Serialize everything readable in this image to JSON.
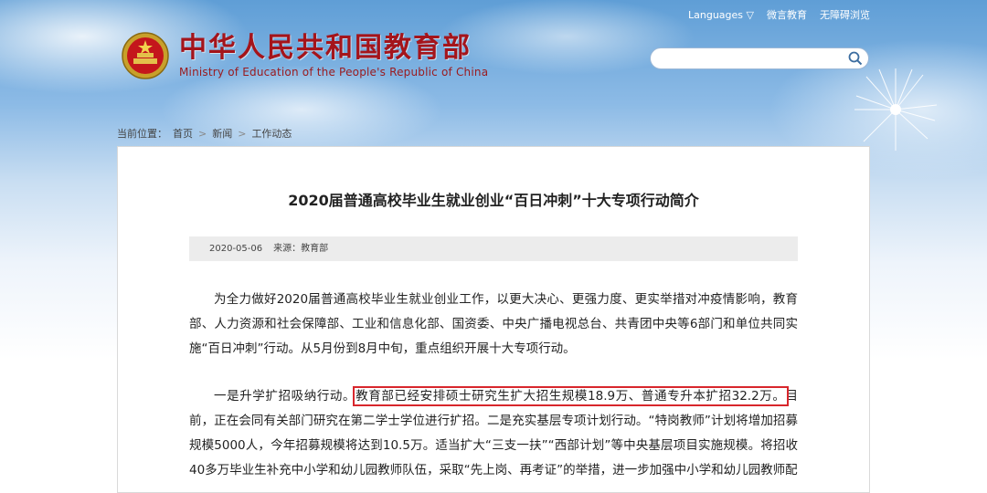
{
  "header": {
    "top_links": [
      "Languages ▽",
      "微言教育",
      "无障碍浏览"
    ],
    "site_title": "中华人民共和国教育部",
    "site_subtitle": "Ministry of Education of the People's Republic of China"
  },
  "breadcrumb": {
    "label": "当前位置：",
    "items": [
      "首页",
      "新闻",
      "工作动态"
    ],
    "separator": ">"
  },
  "article": {
    "title": "2020届普通高校毕业生就业创业“百日冲刺”十大专项行动简介",
    "date": "2020-05-06",
    "source": "来源：教育部",
    "paragraph1": "为全力做好2020届普通高校毕业生就业创业工作，以更大决心、更强力度、更实举措对冲疫情影响，教育部、人力资源和社会保障部、工业和信息化部、国资委、中央广播电视总台、共青团中央等6部门和单位共同实施“百日冲刺”行动。从5月份到8月中旬，重点组织开展十大专项行动。",
    "paragraph2_start": "一是升学扩招吸纳行动。",
    "paragraph2_highlight": "教育部已经安排硕士研究生扩大招生规模18.9万、普通专升本扩招32.2万。",
    "paragraph2_rest": "目前，正在会同有关部门研究在第二学士学位进行扩招。二是充实基层专项计划行动。“特岗教师”计划将增加招募规模5000人，今年招募规模将达到10.5万。适当扩大“三支一扶”“西部计划”等中央基层项目实施规模。将招收40多万毕业生补充中小学和幼儿园教师队伍，采取“先上岗、再考证”的举措，进一步加强中小学和幼儿园教师配"
  },
  "colors": {
    "brand_red": "#a4141b",
    "highlight_border": "#d8262c",
    "meta_bar": "#ececec"
  },
  "icons": [
    "national-emblem-icon",
    "search-icon",
    "dandelion-icon"
  ]
}
